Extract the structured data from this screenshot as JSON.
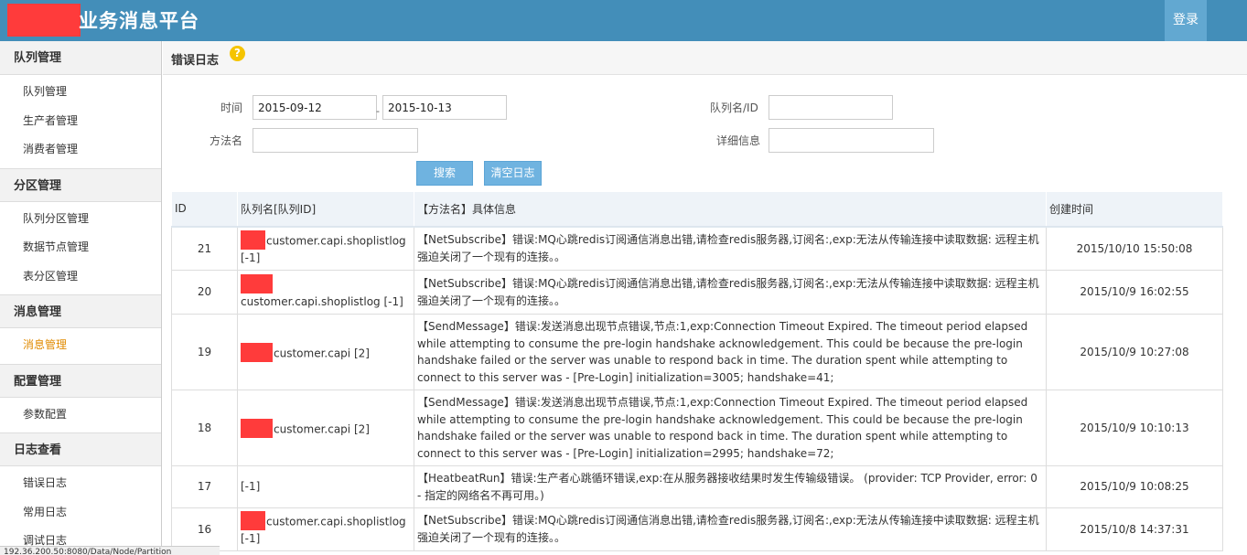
{
  "header": {
    "title": "业务消息平台",
    "login_label": "登录"
  },
  "sidebar": {
    "groups": [
      {
        "title": "队列管理",
        "items": [
          "队列管理",
          "生产者管理",
          "消费者管理"
        ]
      },
      {
        "title": "分区管理",
        "items": [
          "队列分区管理",
          "数据节点管理",
          "表分区管理"
        ]
      },
      {
        "title": "消息管理",
        "items": [
          "消息管理"
        ]
      },
      {
        "title": "配置管理",
        "items": [
          "参数配置"
        ]
      },
      {
        "title": "日志查看",
        "items": [
          "错误日志",
          "常用日志",
          "调试日志"
        ]
      }
    ],
    "active_item": "消息管理"
  },
  "page": {
    "title": "错误日志",
    "help_icon": "?"
  },
  "form": {
    "time_label": "时间",
    "date_from": "2015-09-12",
    "date_to": "2015-10-13",
    "date_sep": "-",
    "queue_label": "队列名/ID",
    "queue_value": "",
    "method_label": "方法名",
    "method_value": "",
    "detail_label": "详细信息",
    "detail_value": "",
    "search_label": "搜索",
    "clear_label": "清空日志"
  },
  "table": {
    "columns": [
      "ID",
      "队列名[队列ID]",
      "【方法名】具体信息",
      "创建时间"
    ],
    "rows": [
      {
        "id": "21",
        "queue": "customer.capi.shoplistlog [-1]",
        "info": "【NetSubscribe】错误:MQ心跳redis订阅通信消息出错,请检查redis服务器,订阅名:,exp:无法从传输连接中读取数据: 远程主机强迫关闭了一个现有的连接。。",
        "time": "2015/10/10 15:50:08"
      },
      {
        "id": "20",
        "queue": "customer.capi.shoplistlog [-1]",
        "info": "【NetSubscribe】错误:MQ心跳redis订阅通信消息出错,请检查redis服务器,订阅名:,exp:无法从传输连接中读取数据: 远程主机强迫关闭了一个现有的连接。。",
        "time": "2015/10/9 16:02:55"
      },
      {
        "id": "19",
        "queue": "customer.capi [2]",
        "info": "【SendMessage】错误:发送消息出现节点错误,节点:1,exp:Connection Timeout Expired. The timeout period elapsed while attempting to consume the pre-login handshake acknowledgement. This could be because the pre-login handshake failed or the server was unable to respond back in time. The duration spent while attempting to connect to this server was - [Pre-Login] initialization=3005; handshake=41;",
        "time": "2015/10/9 10:27:08"
      },
      {
        "id": "18",
        "queue": "customer.capi [2]",
        "info": "【SendMessage】错误:发送消息出现节点错误,节点:1,exp:Connection Timeout Expired. The timeout period elapsed while attempting to consume the pre-login handshake acknowledgement. This could be because the pre-login handshake failed or the server was unable to respond back in time. The duration spent while attempting to connect to this server was - [Pre-Login] initialization=2995; handshake=72;",
        "time": "2015/10/9 10:10:13"
      },
      {
        "id": "17",
        "queue": "[-1]",
        "info": "【HeatbeatRun】错误:生产者心跳循环错误,exp:在从服务器接收结果时发生传输级错误。 (provider: TCP Provider, error: 0 - 指定的网络名不再可用。)",
        "time": "2015/10/9 10:08:25"
      },
      {
        "id": "16",
        "queue": "customer.capi.shoplistlog [-1]",
        "info": "【NetSubscribe】错误:MQ心跳redis订阅通信消息出错,请检查redis服务器,订阅名:,exp:无法从传输连接中读取数据: 远程主机强迫关闭了一个现有的连接。。",
        "time": "2015/10/8 14:37:31"
      }
    ]
  },
  "statusbar": {
    "text": "192.36.200.50:8080/Data/Node/Partition"
  },
  "colors": {
    "header_bg": "#438eb9",
    "login_bg": "#62a8d1",
    "active_nav": "#e08a00",
    "button_bg": "#6fb3e0",
    "redaction": "#ff3b3b"
  }
}
